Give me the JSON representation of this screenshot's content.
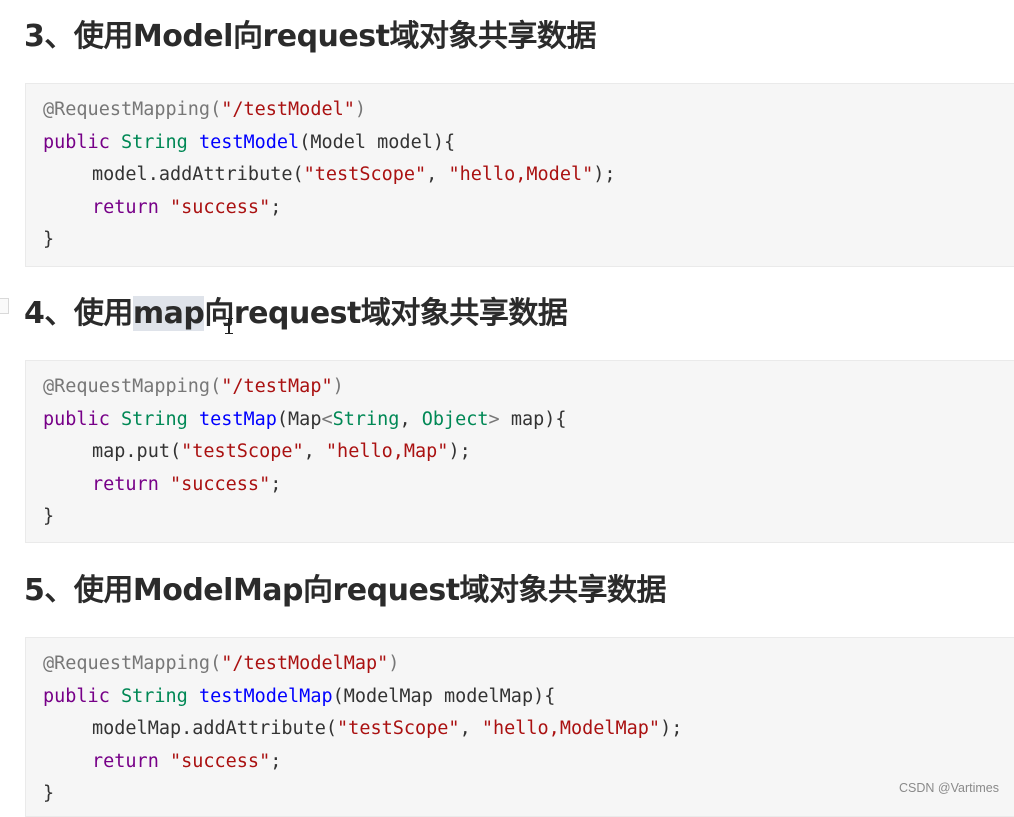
{
  "sections": [
    {
      "heading": "3、使用Model向request域对象共享数据",
      "code": [
        {
          "indent": false,
          "tokens": [
            {
              "c": "ann",
              "t": "@RequestMapping("
            },
            {
              "c": "str",
              "t": "\"/testModel\""
            },
            {
              "c": "ann",
              "t": ")"
            }
          ]
        },
        {
          "indent": false,
          "tokens": [
            {
              "c": "kw",
              "t": "public"
            },
            {
              "c": "pl",
              "t": " "
            },
            {
              "c": "ty",
              "t": "String"
            },
            {
              "c": "pl",
              "t": " "
            },
            {
              "c": "fn",
              "t": "testModel"
            },
            {
              "c": "pl",
              "t": "(Model model){"
            }
          ]
        },
        {
          "indent": true,
          "tokens": [
            {
              "c": "pl",
              "t": "model.addAttribute("
            },
            {
              "c": "str",
              "t": "\"testScope\""
            },
            {
              "c": "pl",
              "t": ", "
            },
            {
              "c": "str",
              "t": "\"hello,Model\""
            },
            {
              "c": "pl",
              "t": ");"
            }
          ]
        },
        {
          "indent": true,
          "tokens": [
            {
              "c": "kw",
              "t": "return"
            },
            {
              "c": "pl",
              "t": " "
            },
            {
              "c": "str",
              "t": "\"success\""
            },
            {
              "c": "pl",
              "t": ";"
            }
          ]
        },
        {
          "indent": false,
          "tokens": [
            {
              "c": "pl",
              "t": "}"
            }
          ]
        }
      ]
    },
    {
      "heading_before": "4、使用",
      "heading_selected": "map",
      "heading_after": "向request域对象共享数据",
      "code": [
        {
          "indent": false,
          "tokens": [
            {
              "c": "ann",
              "t": "@RequestMapping("
            },
            {
              "c": "str",
              "t": "\"/testMap\""
            },
            {
              "c": "ann",
              "t": ")"
            }
          ]
        },
        {
          "indent": false,
          "tokens": [
            {
              "c": "kw",
              "t": "public"
            },
            {
              "c": "pl",
              "t": " "
            },
            {
              "c": "ty",
              "t": "String"
            },
            {
              "c": "pl",
              "t": " "
            },
            {
              "c": "fn",
              "t": "testMap"
            },
            {
              "c": "pl",
              "t": "(Map"
            },
            {
              "c": "ann",
              "t": "<"
            },
            {
              "c": "ty",
              "t": "String"
            },
            {
              "c": "pl",
              "t": ", "
            },
            {
              "c": "ty",
              "t": "Object"
            },
            {
              "c": "ann",
              "t": ">"
            },
            {
              "c": "pl",
              "t": " map){"
            }
          ]
        },
        {
          "indent": true,
          "tokens": [
            {
              "c": "pl",
              "t": "map.put("
            },
            {
              "c": "str",
              "t": "\"testScope\""
            },
            {
              "c": "pl",
              "t": ", "
            },
            {
              "c": "str",
              "t": "\"hello,Map\""
            },
            {
              "c": "pl",
              "t": ");"
            }
          ]
        },
        {
          "indent": true,
          "tokens": [
            {
              "c": "kw",
              "t": "return"
            },
            {
              "c": "pl",
              "t": " "
            },
            {
              "c": "str",
              "t": "\"success\""
            },
            {
              "c": "pl",
              "t": ";"
            }
          ]
        },
        {
          "indent": false,
          "tokens": [
            {
              "c": "pl",
              "t": "}"
            }
          ]
        }
      ]
    },
    {
      "heading": "5、使用ModelMap向request域对象共享数据",
      "code": [
        {
          "indent": false,
          "tokens": [
            {
              "c": "ann",
              "t": "@RequestMapping("
            },
            {
              "c": "str",
              "t": "\"/testModelMap\""
            },
            {
              "c": "ann",
              "t": ")"
            }
          ]
        },
        {
          "indent": false,
          "tokens": [
            {
              "c": "kw",
              "t": "public"
            },
            {
              "c": "pl",
              "t": " "
            },
            {
              "c": "ty",
              "t": "String"
            },
            {
              "c": "pl",
              "t": " "
            },
            {
              "c": "fn",
              "t": "testModelMap"
            },
            {
              "c": "pl",
              "t": "(ModelMap modelMap){"
            }
          ]
        },
        {
          "indent": true,
          "tokens": [
            {
              "c": "pl",
              "t": "modelMap.addAttribute("
            },
            {
              "c": "str",
              "t": "\"testScope\""
            },
            {
              "c": "pl",
              "t": ", "
            },
            {
              "c": "str",
              "t": "\"hello,ModelMap\""
            },
            {
              "c": "pl",
              "t": ");"
            }
          ]
        },
        {
          "indent": true,
          "tokens": [
            {
              "c": "kw",
              "t": "return"
            },
            {
              "c": "pl",
              "t": " "
            },
            {
              "c": "str",
              "t": "\"success\""
            },
            {
              "c": "pl",
              "t": ";"
            }
          ]
        },
        {
          "indent": false,
          "tokens": [
            {
              "c": "pl",
              "t": "}"
            }
          ]
        }
      ]
    }
  ],
  "watermark": "CSDN @Vartimes",
  "colors": {
    "annotation": "#777777",
    "keyword": "#770088",
    "type": "#008855",
    "function": "#0000ff",
    "string": "#aa1111",
    "code_background": "#f6f6f6",
    "selection": "#dfe3ea"
  },
  "icons": {
    "text_cursor": "ibeam-cursor-icon",
    "gutter": "gutter-marker-icon"
  }
}
